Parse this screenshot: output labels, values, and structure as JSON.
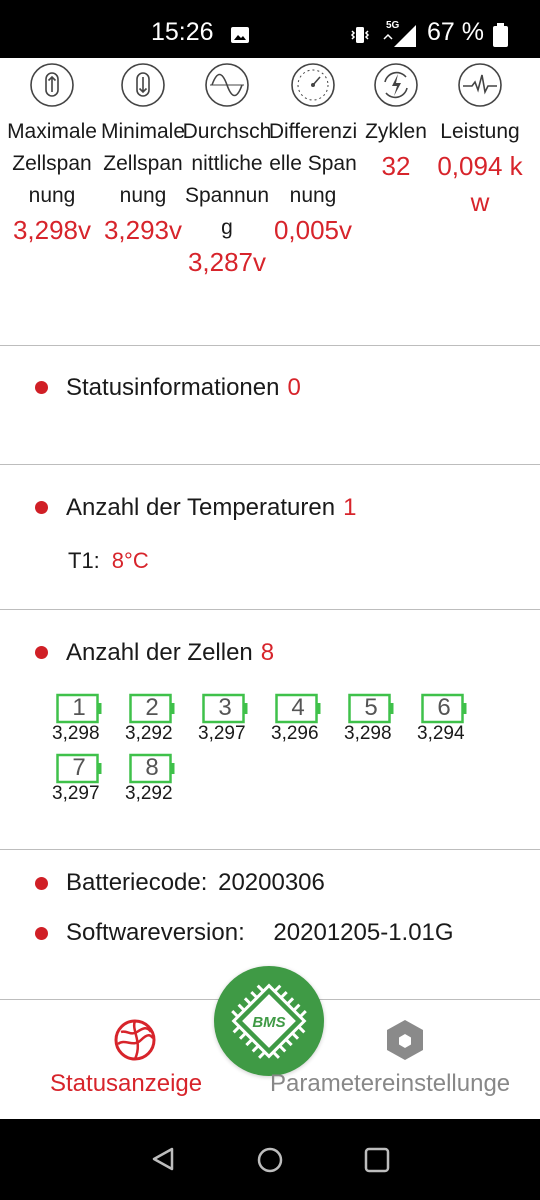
{
  "status_bar": {
    "time": "15:26",
    "network": "5G",
    "battery_percent": "67 %"
  },
  "stats": [
    {
      "label": "Maximale Zellspannung",
      "value": "3,298v",
      "icon": "arrow-up-cylinder-icon"
    },
    {
      "label": "Minimale Zellspannung",
      "value": "3,293v",
      "icon": "arrow-down-cylinder-icon"
    },
    {
      "label": "Durchschnittliche Spannung",
      "value": "3,287v",
      "icon": "sine-wave-icon"
    },
    {
      "label": "Differenzielle Spannung",
      "value": "0,005v",
      "icon": "gauge-icon"
    },
    {
      "label": "Zyklen",
      "value": "32",
      "icon": "cycle-bolt-icon"
    },
    {
      "label": "Leistung",
      "value": "0,094 kw",
      "icon": "pulse-bolt-icon"
    }
  ],
  "status_info": {
    "title": "Statusinformationen",
    "count": "0"
  },
  "temperatures": {
    "title": "Anzahl der Temperaturen",
    "count": "1",
    "items": [
      {
        "label": "T1:",
        "value": "8°C"
      }
    ]
  },
  "cells": {
    "title": "Anzahl der Zellen",
    "count": "8",
    "items": [
      {
        "number": "1",
        "voltage": "3,298"
      },
      {
        "number": "2",
        "voltage": "3,292"
      },
      {
        "number": "3",
        "voltage": "3,297"
      },
      {
        "number": "4",
        "voltage": "3,296"
      },
      {
        "number": "5",
        "voltage": "3,298"
      },
      {
        "number": "6",
        "voltage": "3,294"
      },
      {
        "number": "7",
        "voltage": "3,297"
      },
      {
        "number": "8",
        "voltage": "3,292"
      }
    ]
  },
  "info": {
    "battery_code_label": "Batteriecode:",
    "battery_code": "20200306",
    "software_label": "Softwareversion:",
    "software_version": "20201205-1.01G"
  },
  "bottom_nav": {
    "status_tab": "Statusanzeige",
    "fab_label": "BMS",
    "param_tab": "Parametereinstellunge"
  },
  "colors": {
    "accent_red": "#d7242b",
    "cell_green": "#3fc14a",
    "fab_green": "#3f9a45"
  }
}
